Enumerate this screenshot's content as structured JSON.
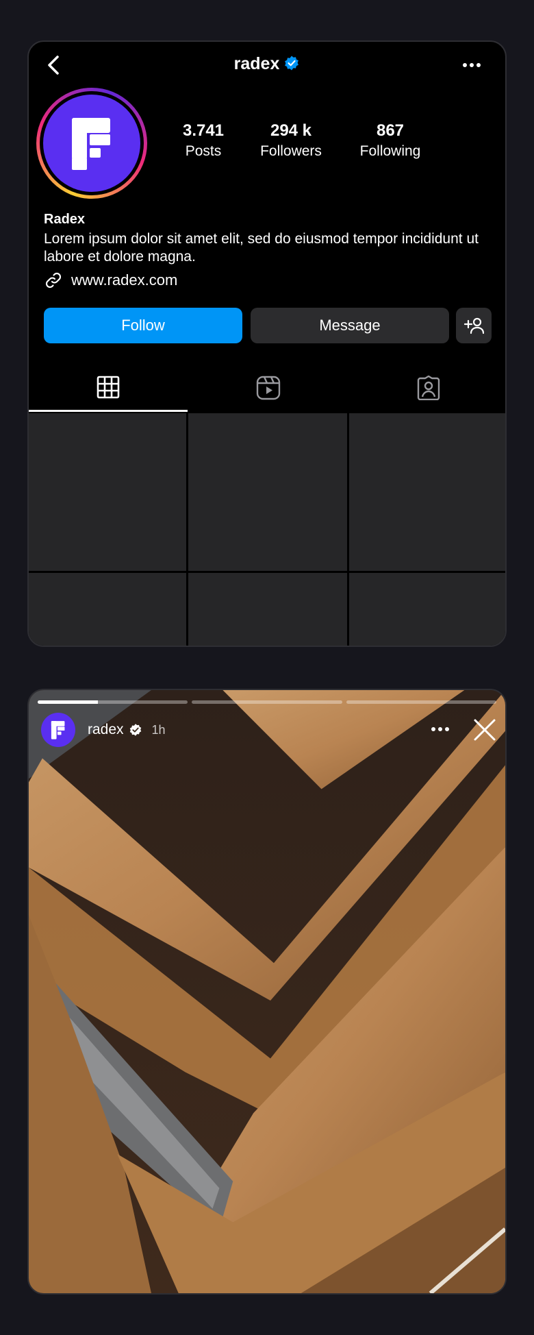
{
  "profile": {
    "username": "radex",
    "stats": [
      {
        "value": "3.741",
        "label": "Posts"
      },
      {
        "value": "294 k",
        "label": "Followers"
      },
      {
        "value": "867",
        "label": "Following"
      }
    ],
    "display_name": "Radex",
    "bio": "Lorem ipsum dolor sit amet elit, sed do eiusmod tempor incididunt ut labore et dolore magna.",
    "website": "www.radex.com",
    "follow_label": "Follow",
    "message_label": "Message",
    "tabs": [
      {
        "icon": "grid-icon",
        "active": true
      },
      {
        "icon": "reels-icon",
        "active": false
      },
      {
        "icon": "tagged-icon",
        "active": false
      }
    ],
    "colors": {
      "accent": "#0095f6",
      "verified": "#0095f6",
      "avatar_bg": "#5a2ff1"
    }
  },
  "story": {
    "username": "radex",
    "time": "1h",
    "progress": [
      0.4,
      0,
      0
    ],
    "icons": [
      "more-icon",
      "close-icon",
      "verified-badge-icon"
    ]
  }
}
